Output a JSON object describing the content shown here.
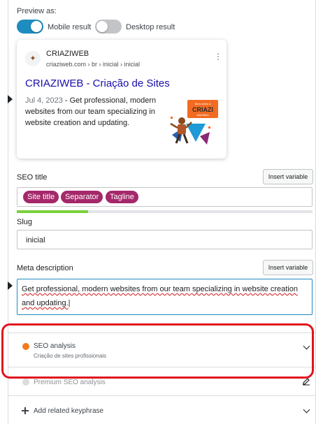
{
  "preview": {
    "label": "Preview as:",
    "mobile_label": "Mobile result",
    "desktop_label": "Desktop result",
    "mobile_selected": true
  },
  "snippet": {
    "site_name": "CRIAZIWEB",
    "url": "criaziweb.com › br › inicial › inicial",
    "title": "CRIAZIWEB - Criação de Sites",
    "date": "Jul 4, 2023",
    "separator": " - ",
    "description": "Get professional, modern websites from our team specializing in website creation and updating.",
    "thumb_line1": "Bem-vindo à",
    "thumb_line2": "CRIAZI",
    "thumb_line3": "WebSites"
  },
  "seo_title": {
    "label": "SEO title",
    "insert_label": "Insert variable",
    "chips": [
      "Site title",
      "Separator",
      "Tagline"
    ],
    "progress": 0.24,
    "progress_color": "#7ad03a"
  },
  "slug": {
    "label": "Slug",
    "value": "inicial"
  },
  "meta": {
    "label": "Meta description",
    "insert_label": "Insert variable",
    "value": "Get professional, modern websites from our team specializing in website creation and updating."
  },
  "sections": {
    "seo_analysis": {
      "title": "SEO analysis",
      "subtitle": "Criação de sites profissionais",
      "status_color": "#ee7c1b"
    },
    "premium": {
      "title": "Premium SEO analysis",
      "icon": "edit-icon"
    },
    "related": {
      "title": "Add related keyphrase",
      "icon": "plus-icon"
    }
  },
  "colors": {
    "accent": "#1e8cbe",
    "chip": "#a4286a",
    "link": "#1a0dab",
    "highlight": "#e0141f"
  }
}
